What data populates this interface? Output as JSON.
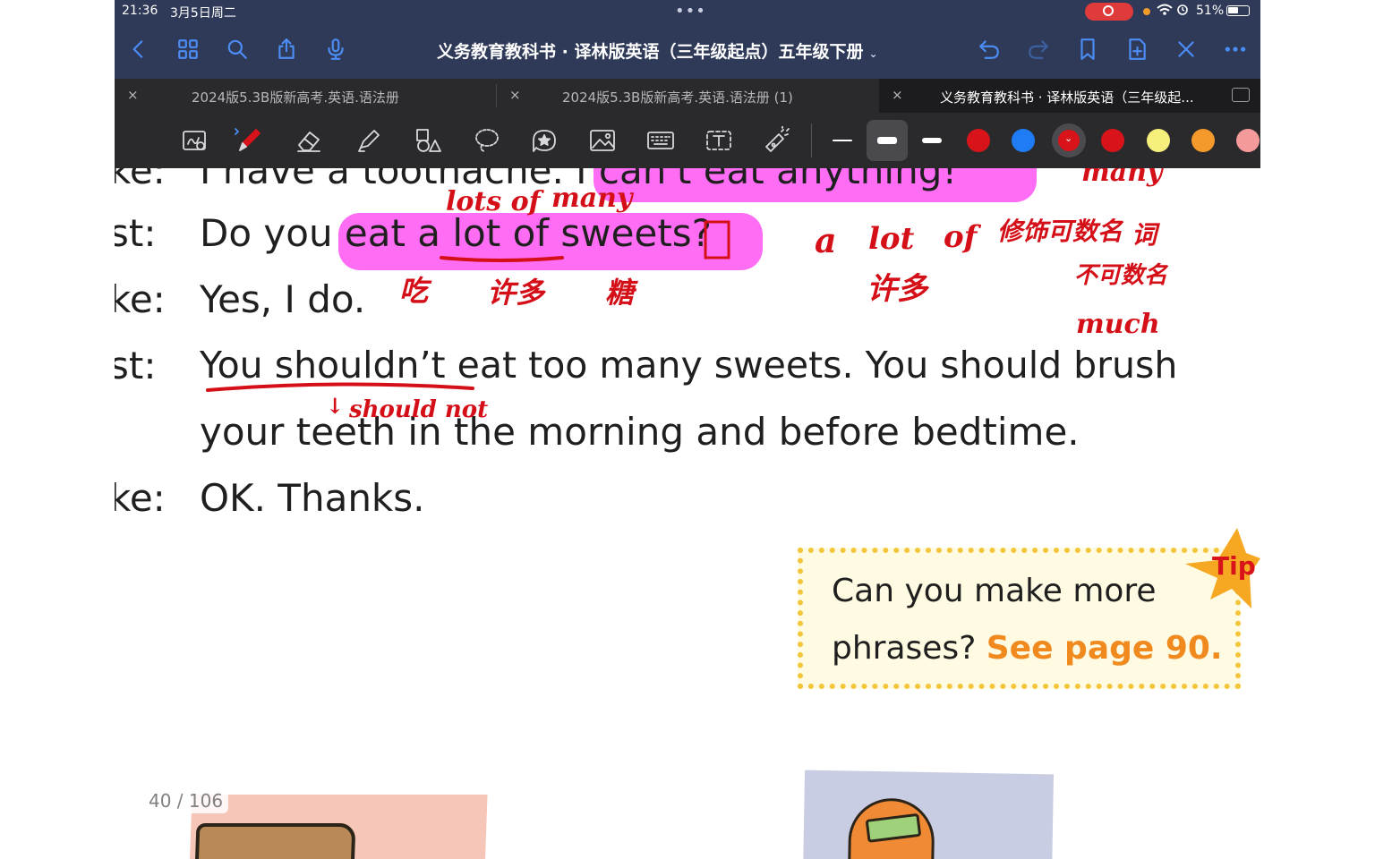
{
  "status_bar": {
    "time": "21:36",
    "date": "3月5日周二",
    "battery": "51%",
    "multitask": "•••"
  },
  "header": {
    "title": "义务教育教科书 · 译林版英语（三年级起点）五年级下册",
    "title_chevron": "⌄",
    "accent_color": "#4c8cf5"
  },
  "tabs": [
    {
      "label": "2024版5.3B版新高考.英语.语法册",
      "close": "×"
    },
    {
      "label": "2024版5.3B版新高考.英语.语法册 (1)",
      "close": "×"
    },
    {
      "label": "义务教育教科书 · 译林版英语（三年级起...",
      "close": "×"
    }
  ],
  "toolbar": {
    "tools": [
      "lasso-zoom-icon",
      "pen-icon",
      "eraser-icon",
      "highlighter-icon",
      "shapes-icon",
      "lasso-icon",
      "sticker-icon",
      "image-icon",
      "keyboard-icon",
      "text-icon",
      "laser-pointer-icon"
    ],
    "selected_swatch_mark": "⌄",
    "colors": [
      "#d8141a",
      "#1f7cf4",
      "#d8141a",
      "#d8141a",
      "#f7ef7c",
      "#f49a2c",
      "#f59a9a"
    ]
  },
  "document": {
    "dialogue": [
      {
        "speaker": "ke:",
        "text": "I have a toothache. I can't eat anything!"
      },
      {
        "speaker": "st:",
        "text": "Do you eat a lot of sweets?"
      },
      {
        "speaker": "ke:",
        "text": "Yes, I do."
      },
      {
        "speaker": "st:",
        "text": "You shouldn’t eat too many sweets. You should brush"
      },
      {
        "speaker": "",
        "text": "your teeth in the morning and before bedtime."
      },
      {
        "speaker": "ke:",
        "text": "OK. Thanks."
      }
    ],
    "tip": {
      "badge": "Tip",
      "line1": "Can you make more",
      "line2_prefix": "phrases? ",
      "line2_link": "See page 90."
    },
    "page_indicator": "40 / 106"
  },
  "annotations": {
    "above_sweets": [
      "lots of",
      "many"
    ],
    "right_top": "many",
    "right_side": [
      "a",
      "lot",
      "of",
      "修饰可数名",
      "词",
      "许多",
      "不可数名",
      "much"
    ],
    "under_words": [
      "吃",
      "许多",
      "糖"
    ],
    "under_shouldnt": "should not",
    "arrow": "↓"
  }
}
